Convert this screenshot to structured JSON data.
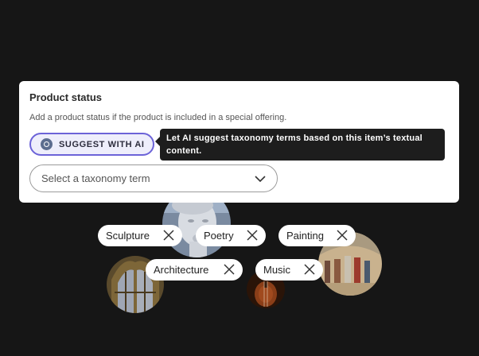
{
  "field": {
    "title": "Product status",
    "description": "Add a product status if the product is included in a special offering."
  },
  "ai_button": {
    "label": "SUGGEST WITH AI",
    "icon": "ai-sparkle-icon",
    "accent": "#6c63d8"
  },
  "tooltip": {
    "text": "Let AI suggest taxonomy terms based on this item’s textual content."
  },
  "taxonomy_select": {
    "placeholder": "Select a taxonomy term",
    "icon": "chevron-down-icon"
  },
  "tags": [
    {
      "label": "Sculpture"
    },
    {
      "label": "Poetry"
    },
    {
      "label": "Painting"
    },
    {
      "label": "Architecture"
    },
    {
      "label": "Music"
    }
  ],
  "images": [
    "statue-head",
    "gothic-window",
    "school-of-athens-painting",
    "violin"
  ]
}
